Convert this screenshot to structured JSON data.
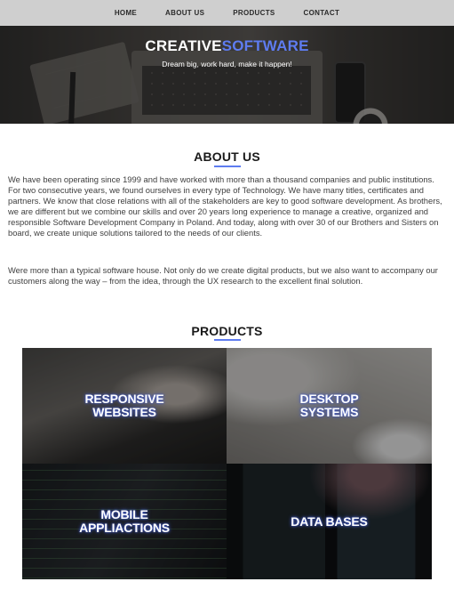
{
  "nav": {
    "items": [
      {
        "label": "HOME"
      },
      {
        "label": "ABOUT US"
      },
      {
        "label": "PRODUCTS"
      },
      {
        "label": "CONTACT"
      }
    ]
  },
  "hero": {
    "title_part1": "CREATIVE",
    "title_part2": "SOFTWARE",
    "tagline": "Dream big, work hard, make it happen!"
  },
  "about": {
    "heading": "ABOUT US",
    "paragraph1": "We have been operating since 1999 and have worked with more than a thousand companies and public institutions. For two consecutive years, we found ourselves in every type of Technology. We have many titles, certificates and partners. We know that close relations with all of the stakeholders are key to good software development. As brothers, we are different but we combine our skills and over 20 years long experience to manage a creative, organized and responsible Software Development Company in Poland. And today, along with over 30 of our Brothers and Sisters on board, we create unique solutions tailored to the needs of our clients.",
    "paragraph2": "Were more than a typical software house. Not only do we create digital products, but we also want to accompany our customers along the way – from the idea, through the UX research to the excellent final solution."
  },
  "products": {
    "heading": "PRODUCTS",
    "items": [
      {
        "label": "RESPONSIVE\nWEBSITES"
      },
      {
        "label": "DESKTOP\nSYSTEMS"
      },
      {
        "label": "MOBILE\nAPPLIACTIONS"
      },
      {
        "label": "DATA BASES"
      }
    ]
  },
  "colors": {
    "accent": "#5e7cf0",
    "nav_bg": "#cfcfcf"
  }
}
